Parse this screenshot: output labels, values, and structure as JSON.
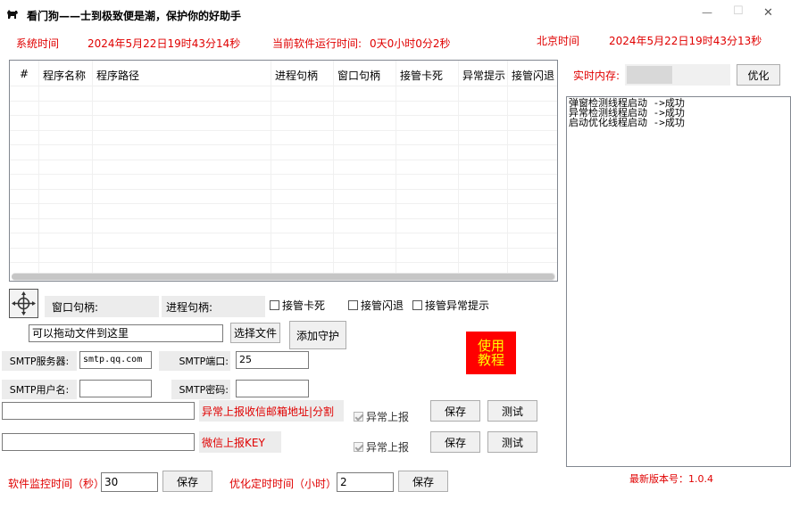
{
  "window": {
    "title": "看门狗——士到极致便是潮，保护你的好助手",
    "icon": "dog-icon",
    "min_glyph": "—",
    "max_glyph": "☐",
    "close_glyph": "✕"
  },
  "status": {
    "system_time_label": "系统时间",
    "system_time_value": "2024年5月22日19时43分14秒",
    "runtime_label": "当前软件运行时间:",
    "runtime_value": "0天0小时0分2秒",
    "beijing_label": "北京时间",
    "beijing_value": "2024年5月22日19时43分13秒"
  },
  "table": {
    "columns": [
      "#",
      "程序名称",
      "程序路径",
      "进程句柄",
      "窗口句柄",
      "接管卡死",
      "异常提示",
      "接管闪退"
    ],
    "rows": []
  },
  "memory": {
    "label": "实时内存:",
    "value_fraction": 0.45,
    "optimize_label": "优化"
  },
  "log": {
    "lines": [
      "弹窗检测线程启动 ->成功",
      "异常检测线程启动 ->成功",
      "启动优化线程启动 ->成功"
    ]
  },
  "handles": {
    "window_label": "窗口句柄:",
    "process_label": "进程句柄:",
    "crosshair_icon": "crosshair-icon"
  },
  "options": {
    "takeover_freeze": "接管卡死",
    "takeover_crash": "接管闪退",
    "takeover_error": "接管异常提示"
  },
  "file": {
    "drop_value": "可以拖动文件到这里",
    "select_label": "选择文件",
    "add_guard_label": "添加守护"
  },
  "tutorial": {
    "label_line1": "使用",
    "label_line2": "教程",
    "color": "#ff0000",
    "text_color": "#ffff00"
  },
  "smtp": {
    "server_label": "SMTP服务器:",
    "server_value": "smtp.qq.com",
    "port_label": "SMTP端口:",
    "port_value": "25",
    "user_label": "SMTP用户名:",
    "user_value": "",
    "password_label": "SMTP密码:",
    "password_value": ""
  },
  "report": {
    "email_value": "",
    "email_hint": "异常上报收信邮箱地址|分割",
    "email_report_label": "异常上报",
    "email_save": "保存",
    "email_test": "测试",
    "wechat_value": "",
    "wechat_hint": "微信上报KEY",
    "wechat_report_label": "异常上报",
    "wechat_save": "保存",
    "wechat_test": "测试"
  },
  "bottom": {
    "monitor_label": "软件监控时间（秒）",
    "monitor_value": "30",
    "monitor_save": "保存",
    "optimize_label": "优化定时时间（小时）",
    "optimize_value": "2",
    "optimize_save": "保存",
    "version_label": "最新版本号：1.0.4"
  }
}
